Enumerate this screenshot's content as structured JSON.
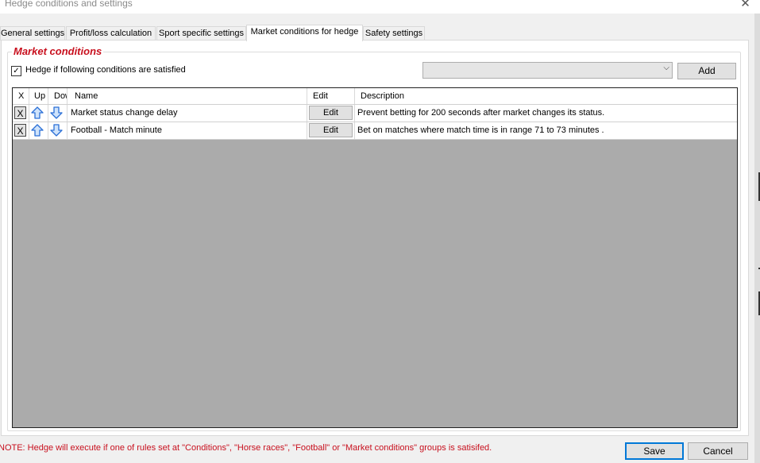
{
  "window": {
    "title": "Hedge conditions and settings",
    "close_glyph": "✕"
  },
  "tabs": [
    {
      "label": "General settings"
    },
    {
      "label": "Profit/loss calculation"
    },
    {
      "label": "Sport specific settings"
    },
    {
      "label": "Market conditions for hedge",
      "active": true
    },
    {
      "label": "Safety settings"
    }
  ],
  "group": {
    "legend": "Market conditions",
    "checkbox_label": "Hedge if following conditions are satisfied",
    "checkbox_checked": true,
    "checkmark_glyph": "✓",
    "combo_value": "",
    "combo_chevron": "⌵",
    "add_label": "Add"
  },
  "grid": {
    "headers": {
      "x": "X",
      "up": "Up",
      "down": "Down",
      "name": "Name",
      "edit": "Edit",
      "description": "Description"
    },
    "rows": [
      {
        "x": "X",
        "name": "Market status change delay",
        "edit": "Edit",
        "description": "Prevent betting for 200 seconds after market changes its status."
      },
      {
        "x": "X",
        "name": "Football - Match minute",
        "edit": "Edit",
        "description": "Bet on matches where match time is in range 71 to 73 minutes ."
      }
    ]
  },
  "footer": {
    "note": "NOTE: Hedge will execute if one of rules set at \"Conditions\", \"Horse races\", \"Football\" or \"Market conditions\" groups is satisifed.",
    "save_label": "Save",
    "cancel_label": "Cancel"
  },
  "colors": {
    "accent_red": "#c8101e",
    "focus_blue": "#0078d7",
    "arrow_blue": "#2a6fd6",
    "grid_empty": "#ababab"
  }
}
